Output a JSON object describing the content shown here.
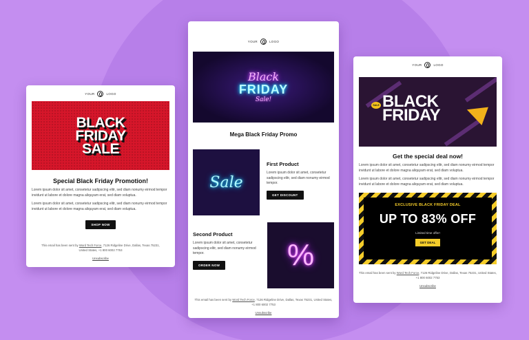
{
  "logo": {
    "left": "YOUR",
    "right": "LOGO"
  },
  "card1": {
    "hero_lines": [
      "BLACK",
      "FRIDAY",
      "SALE"
    ],
    "title": "Special Black Friday Promotion!",
    "para1": "Lorem ipsum dolor sit amet, consetetur sadipscing elitr, sed diam nonumy eirmod tempor invidunt ut labore et dolore magna aliquyam erat, sed diam voluptua.",
    "para2": "Lorem ipsum dolor sit amet, consetetur sadipscing elitr, sed diam nonumy eirmod tempor invidunt ut labore et dolore magna aliquyam erat, sed diam voluptua.",
    "button": "SHOP NOW"
  },
  "card2": {
    "hero": {
      "line1": "Black",
      "line2": "FRIDAY",
      "line3": "Sale!"
    },
    "title": "Mega Black Friday Promo",
    "product1": {
      "image_text": "Sale",
      "title": "First Product",
      "text": "Lorem ipsum dolor sit amet, consetetur sadipscing elitr, sed diam nonumy eirmod tempor.",
      "button": "GET DISCOUNT"
    },
    "product2": {
      "image_text": "%",
      "title": "Second Product",
      "text": "Lorem ipsum dolor sit amet, consetetur sadipscing elitr, sed diam nonumy eirmod tempor.",
      "button": "ORDER NOW"
    }
  },
  "card3": {
    "hero": {
      "badge": "SALE",
      "line1": "BLACK",
      "line2": "FRIDAY"
    },
    "title": "Get the special deal now!",
    "para1": "Lorem ipsum dolor sit amet, consetetur sadipscing elitr, sed diam nonumy eirmod tempor invidunt ut labore et dolore magna aliquyam erat, sed diam voluptua.",
    "para2": "Lorem ipsum dolor sit amet, consetetur sadipscing elitr, sed diam nonumy eirmod tempor invidunt ut labore et dolore magna aliquyam erat, sed diam voluptua.",
    "deal": {
      "label": "EXCLUSIVE BLACK FRIDAY DEAL",
      "headline": "UP TO 83% OFF",
      "sub": "Limited time offer!",
      "button": "GET DEAL"
    }
  },
  "footer": {
    "prefix": "This email has been sent by",
    "company": "Word Tech Force",
    "address": ", 7126 Ridgeline Drive, Dallas, Texas 75231, United States, +1 800 6002 7753",
    "unsubscribe": "Unsubscribe"
  },
  "colors": {
    "background": "#c48ef0",
    "hero_red": "#d6162a",
    "deal_yellow": "#f5cd2a",
    "button_black": "#111111"
  }
}
